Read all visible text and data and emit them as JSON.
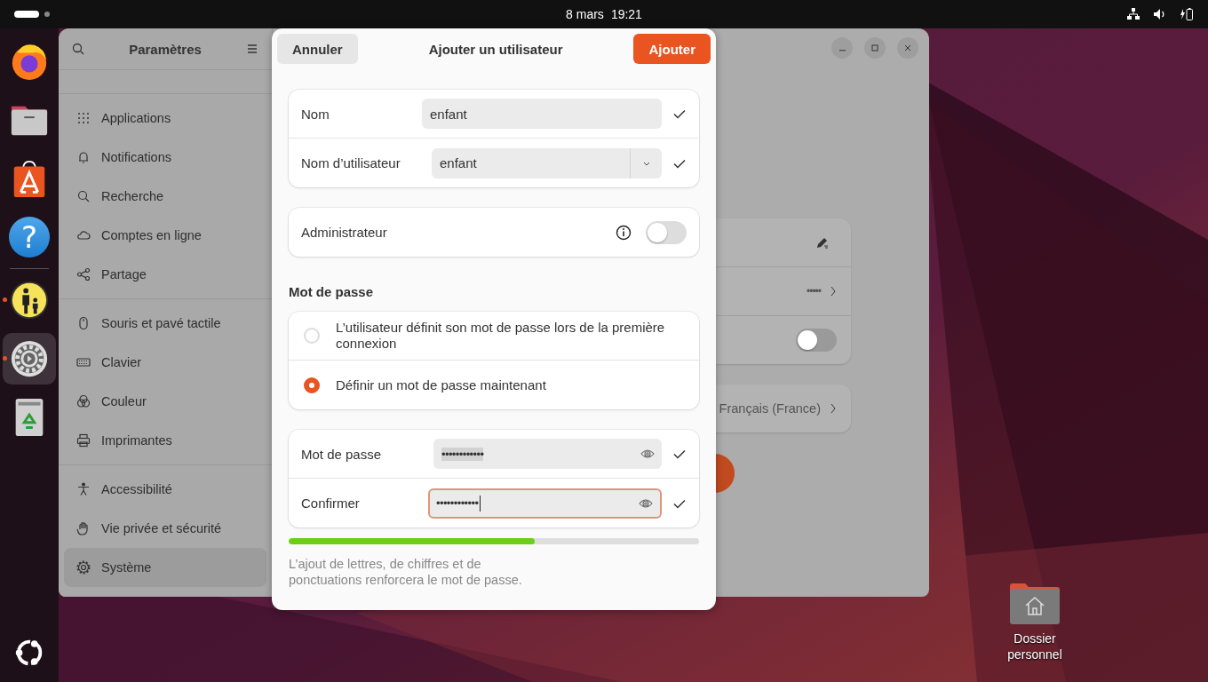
{
  "top_bar": {
    "date": "8 mars",
    "time": "19:21"
  },
  "dock": {
    "favorites": [
      {
        "kind": "browser",
        "running": false,
        "selected": false
      },
      {
        "kind": "files",
        "running": false,
        "selected": false
      },
      {
        "kind": "store",
        "running": false,
        "selected": false
      },
      {
        "kind": "help",
        "glyph": "?",
        "running": false,
        "selected": false
      }
    ],
    "running_apps": [
      {
        "kind": "parental",
        "running": true,
        "selected": false
      },
      {
        "kind": "settings",
        "running": true,
        "selected": true
      },
      {
        "kind": "trash",
        "running": false,
        "selected": false
      }
    ]
  },
  "settings_window": {
    "title": "Paramètres",
    "sidebar_groups": [
      [
        {
          "kind": "grid",
          "label": "Applications",
          "selected": false
        },
        {
          "kind": "bell",
          "label": "Notifications",
          "selected": false
        },
        {
          "kind": "search",
          "label": "Recherche",
          "selected": false
        },
        {
          "kind": "cloud",
          "label": "Comptes en ligne",
          "selected": false
        },
        {
          "kind": "share",
          "label": "Partage",
          "selected": false
        }
      ],
      [
        {
          "kind": "mouse",
          "label": "Souris et pavé tactile",
          "selected": false
        },
        {
          "kind": "keyboard",
          "label": "Clavier",
          "selected": false
        },
        {
          "kind": "color",
          "label": "Couleur",
          "selected": false
        },
        {
          "kind": "printer",
          "label": "Imprimantes",
          "selected": false
        }
      ],
      [
        {
          "kind": "person",
          "label": "Accessibilité",
          "selected": false
        },
        {
          "kind": "hand",
          "label": "Vie privée et sécurité",
          "selected": false
        },
        {
          "kind": "gear",
          "label": "Système",
          "selected": true
        }
      ]
    ],
    "content": {
      "password_dots": "•••••",
      "auto_login_on": false,
      "language": "Français (France)"
    }
  },
  "dialog": {
    "title": "Ajouter un utilisateur",
    "cancel": "Annuler",
    "confirm": "Ajouter",
    "identity_fields": [
      {
        "kind": "entry",
        "label": "Nom",
        "value": "enfant",
        "valid": true
      },
      {
        "kind": "combo",
        "label": "Nom d’utilisateur",
        "value": "enfant",
        "valid": true
      }
    ],
    "admin": {
      "label": "Administrateur",
      "on": false
    },
    "password_heading": "Mot de passe",
    "password_options": [
      {
        "label": "L’utilisateur définit son mot de passe lors de la première connexion",
        "selected": false
      },
      {
        "label": "Définir un mot de passe maintenant",
        "selected": true
      }
    ],
    "password_fields": [
      {
        "label": "Mot de passe",
        "value": "••••••••••••",
        "text_selected": true,
        "focused": false,
        "valid": true
      },
      {
        "label": "Confirmer",
        "value": "••••••••••••",
        "text_selected": false,
        "focused": true,
        "valid": true
      }
    ],
    "strength": {
      "level": 0.6
    },
    "hint": "L’ajout de lettres, de chiffres et de ponctuations renforcera le mot de passe."
  },
  "desktop_icons": [
    {
      "label": "Dossier personnel"
    }
  ]
}
